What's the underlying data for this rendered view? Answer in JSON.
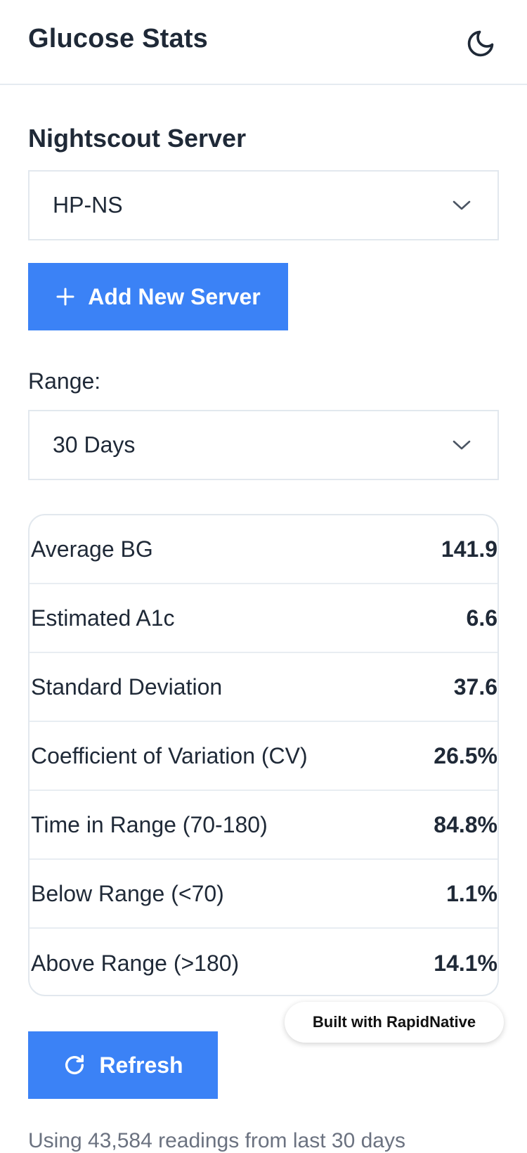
{
  "header": {
    "title": "Glucose Stats",
    "theme_icon": "moon-icon"
  },
  "server": {
    "section_title": "Nightscout Server",
    "selected": "HP-NS",
    "add_button_label": "Add New Server"
  },
  "range": {
    "label": "Range:",
    "selected": "30 Days"
  },
  "stats": [
    {
      "label": "Average BG",
      "value": "141.9"
    },
    {
      "label": "Estimated A1c",
      "value": "6.6"
    },
    {
      "label": "Standard Deviation",
      "value": "37.6"
    },
    {
      "label": "Coefficient of Variation (CV)",
      "value": "26.5%"
    },
    {
      "label": "Time in Range (70-180)",
      "value": "84.8%"
    },
    {
      "label": "Below Range (<70)",
      "value": "1.1%"
    },
    {
      "label": "Above Range (>180)",
      "value": "14.1%"
    }
  ],
  "badge": {
    "label": "Built with RapidNative"
  },
  "refresh": {
    "label": "Refresh"
  },
  "footnote": "Using 43,584 readings from last 30 days",
  "colors": {
    "accent": "#3b82f6",
    "text": "#1f2937",
    "border": "#e2e8ee"
  }
}
